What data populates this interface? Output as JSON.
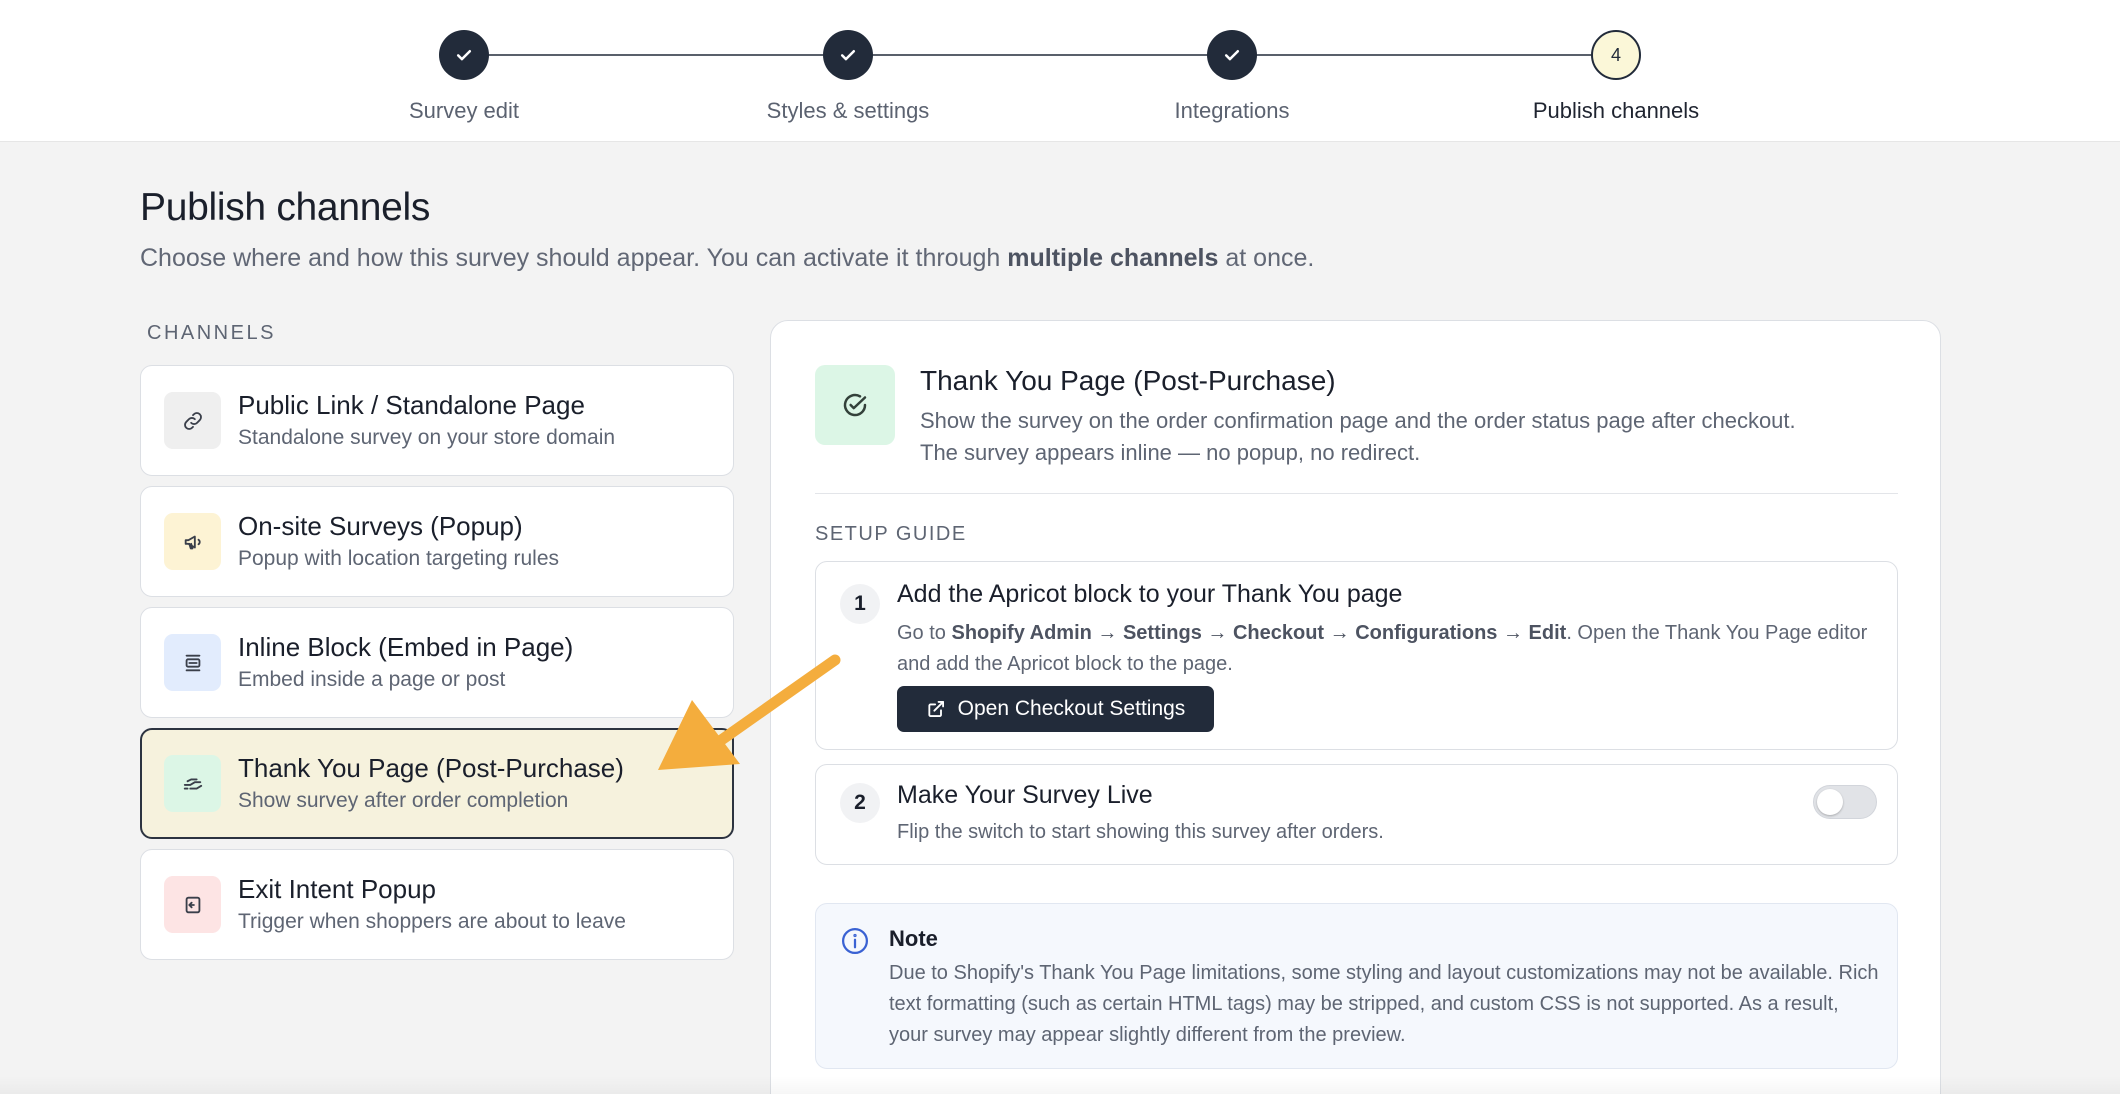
{
  "stepper": {
    "steps": [
      {
        "label": "Survey edit",
        "state": "done"
      },
      {
        "label": "Styles & settings",
        "state": "done"
      },
      {
        "label": "Integrations",
        "state": "done"
      },
      {
        "label": "Publish channels",
        "state": "current",
        "number": "4"
      }
    ]
  },
  "header": {
    "title": "Publish channels",
    "subtitle_pre": "Choose where and how this survey should appear. You can activate it through ",
    "subtitle_bold": "multiple channels",
    "subtitle_post": " at once."
  },
  "channels": {
    "heading": "CHANNELS",
    "items": [
      {
        "title": "Public Link / Standalone Page",
        "desc": "Standalone survey on your store domain",
        "icon": "link-icon",
        "icon_bg": "#efefef"
      },
      {
        "title": "On-site Surveys (Popup)",
        "desc": "Popup with location targeting rules",
        "icon": "megaphone-icon",
        "icon_bg": "#fdf3d4"
      },
      {
        "title": "Inline Block (Embed in Page)",
        "desc": "Embed inside a page or post",
        "icon": "embed-block-icon",
        "icon_bg": "#e2ecfd"
      },
      {
        "title": "Thank You Page (Post-Purchase)",
        "desc": "Show survey after order completion",
        "icon": "hand-icon",
        "icon_bg": "#dcf6e6",
        "active": true
      },
      {
        "title": "Exit Intent Popup",
        "desc": "Trigger when shoppers are about to leave",
        "icon": "exit-icon",
        "icon_bg": "#fde4e4"
      }
    ]
  },
  "detail": {
    "title": "Thank You Page (Post-Purchase)",
    "desc_line1": "Show the survey on the order confirmation page and the order status page after checkout.",
    "desc_line2": "The survey appears inline — no popup, no redirect.",
    "setup_heading": "SETUP GUIDE",
    "steps": [
      {
        "number": "1",
        "title": "Add the Apricot block to your Thank You page",
        "text_pre": "Go to ",
        "text_bold": "Shopify Admin → Settings → Checkout → Configurations → Edit",
        "text_post": ". Open the Thank You Page editor and add the Apricot block to the page.",
        "button_label": "Open Checkout Settings"
      },
      {
        "number": "2",
        "title": "Make Your Survey Live",
        "text": "Flip the switch to start showing this survey after orders.",
        "toggle_on": false
      }
    ],
    "note": {
      "title": "Note",
      "text": "Due to Shopify's Thank You Page limitations, some styling and layout customizations may not be available. Rich text formatting (such as certain HTML tags) may be stripped, and custom CSS is not supported. As a result, your survey may appear slightly different from the preview."
    }
  },
  "colors": {
    "primary_dark": "#222b3a",
    "active_card_bg": "#f6f2dd",
    "arrow": "#f4ad3d",
    "info_blue": "#3a62d3"
  }
}
